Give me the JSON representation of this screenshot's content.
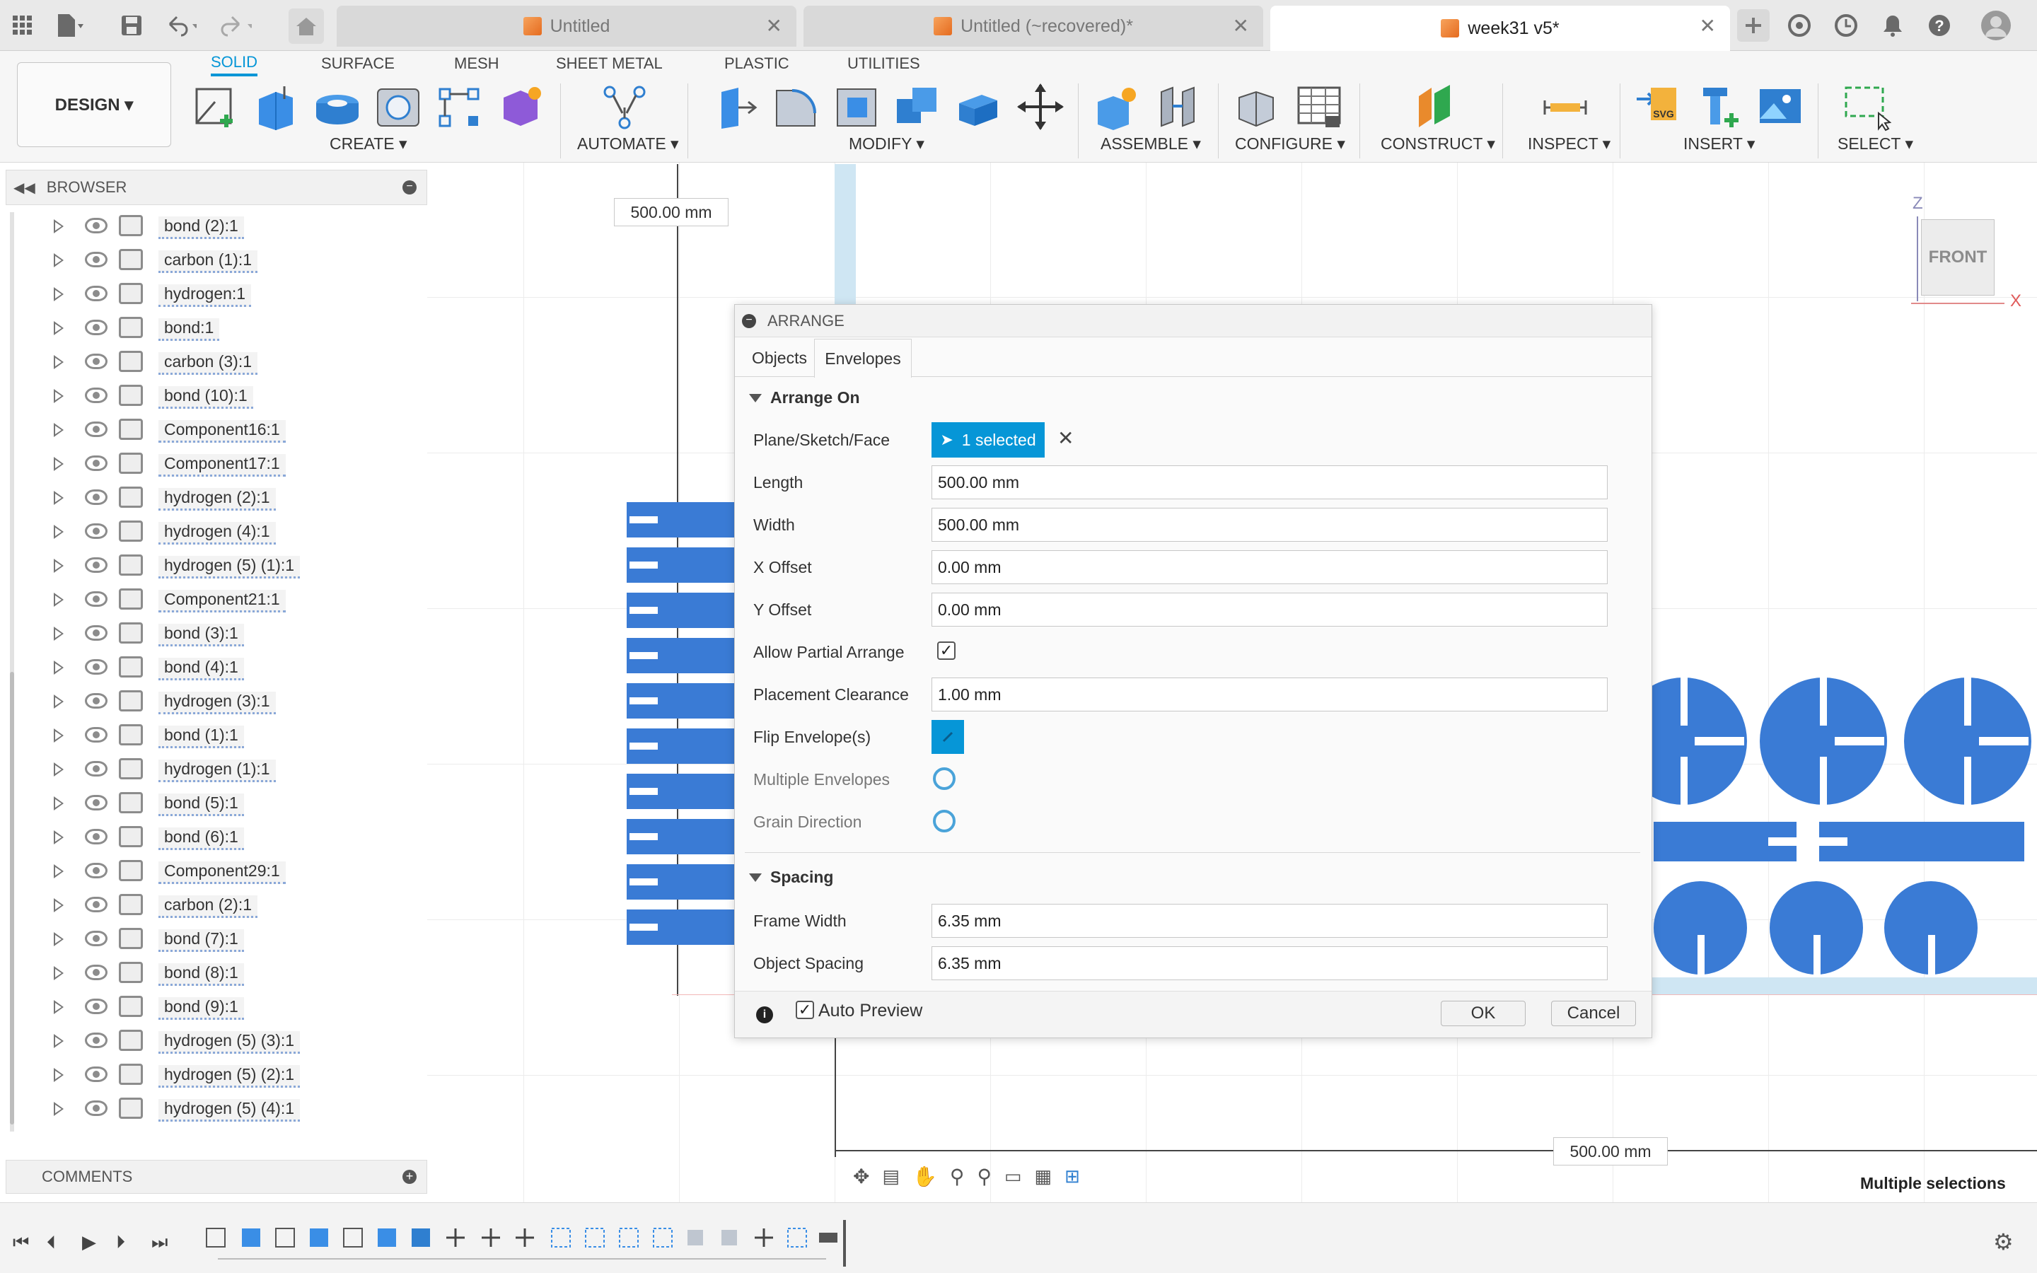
{
  "tabs": [
    {
      "label": "Untitled",
      "active": false
    },
    {
      "label": "Untitled (~recovered)*",
      "active": false
    },
    {
      "label": "week31 v5*",
      "active": true
    }
  ],
  "workspace_tabs": [
    "SOLID",
    "SURFACE",
    "MESH",
    "SHEET METAL",
    "PLASTIC",
    "UTILITIES"
  ],
  "design_button": "DESIGN ▾",
  "tool_groups": {
    "create": "CREATE ▾",
    "automate": "AUTOMATE ▾",
    "modify": "MODIFY ▾",
    "assemble": "ASSEMBLE ▾",
    "configure": "CONFIGURE ▾",
    "construct": "CONSTRUCT ▾",
    "inspect": "INSPECT ▾",
    "insert": "INSERT ▾",
    "select": "SELECT ▾"
  },
  "browser": {
    "title": "BROWSER",
    "items": [
      "bond (2):1",
      "carbon (1):1",
      "hydrogen:1",
      "bond:1",
      "carbon (3):1",
      "bond (10):1",
      "Component16:1",
      "Component17:1",
      "hydrogen (2):1",
      "hydrogen (4):1",
      "hydrogen (5) (1):1",
      "Component21:1",
      "bond (3):1",
      "bond (4):1",
      "hydrogen (3):1",
      "bond (1):1",
      "hydrogen (1):1",
      "bond (5):1",
      "bond (6):1",
      "Component29:1",
      "carbon (2):1",
      "bond (7):1",
      "bond (8):1",
      "bond (9):1",
      "hydrogen (5) (3):1",
      "hydrogen (5) (2):1",
      "hydrogen (5) (4):1"
    ]
  },
  "comments_label": "COMMENTS",
  "viewport": {
    "dim_top": "500.00 mm",
    "dim_bottom": "500.00 mm",
    "viewcube_face": "FRONT",
    "axis_z": "Z",
    "axis_x": "X",
    "status": "Multiple selections",
    "accent": "#3a7bd5"
  },
  "dialog": {
    "title": "ARRANGE",
    "tabs": [
      "Objects",
      "Envelopes"
    ],
    "section_arrange": "Arrange On",
    "plane_label": "Plane/Sketch/Face",
    "plane_value": "1 selected",
    "length_label": "Length",
    "length_value": "500.00 mm",
    "width_label": "Width",
    "width_value": "500.00 mm",
    "xoffset_label": "X Offset",
    "xoffset_value": "0.00 mm",
    "yoffset_label": "Y Offset",
    "yoffset_value": "0.00 mm",
    "partial_label": "Allow Partial Arrange",
    "partial_checked": true,
    "clearance_label": "Placement Clearance",
    "clearance_value": "1.00 mm",
    "flip_label": "Flip Envelope(s)",
    "multiple_label": "Multiple Envelopes",
    "grain_label": "Grain Direction",
    "section_spacing": "Spacing",
    "frame_label": "Frame Width",
    "frame_value": "6.35 mm",
    "object_label": "Object Spacing",
    "object_value": "6.35 mm",
    "auto_preview_label": "Auto Preview",
    "auto_preview_checked": true,
    "ok_label": "OK",
    "cancel_label": "Cancel"
  }
}
